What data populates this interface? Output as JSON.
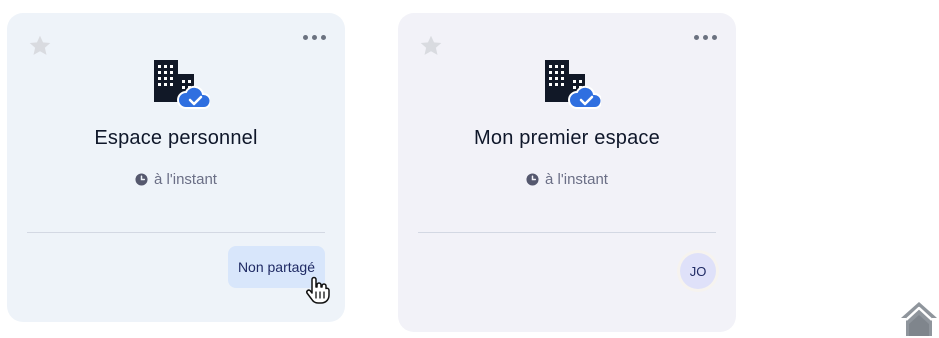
{
  "workspaces": [
    {
      "title": "Espace personnel",
      "time": "à l'instant",
      "share_label": "Non partagé"
    },
    {
      "title": "Mon premier espace",
      "time": "à l'instant",
      "member_initials": "JO"
    }
  ],
  "icons": {
    "favorite": "star-icon",
    "more": "more-dots-icon",
    "space": "building-cloud-icon",
    "time": "clock-icon",
    "home": "home-icon"
  },
  "colors": {
    "card1_bg": "#eef3f9",
    "card2_bg": "#f2f2f8",
    "accent_blue": "#2f6fe0",
    "share_bg": "#d8e6fb",
    "avatar_bg": "#dfe1f9"
  }
}
